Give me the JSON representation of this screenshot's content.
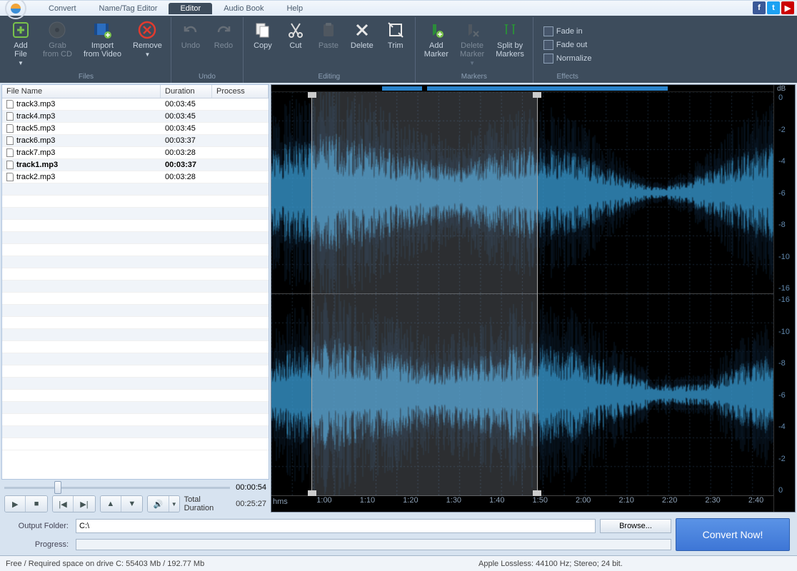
{
  "menu": {
    "tabs": [
      "Convert",
      "Name/Tag Editor",
      "Editor",
      "Audio Book",
      "Help"
    ],
    "active": 2
  },
  "ribbon": {
    "files": {
      "label": "Files",
      "add": "Add\nFile",
      "grab": "Grab\nfrom CD",
      "import": "Import\nfrom Video",
      "remove": "Remove"
    },
    "undo": {
      "label": "Undo",
      "undo": "Undo",
      "redo": "Redo"
    },
    "editing": {
      "label": "Editing",
      "copy": "Copy",
      "cut": "Cut",
      "paste": "Paste",
      "delete": "Delete",
      "trim": "Trim"
    },
    "markers": {
      "label": "Markers",
      "add": "Add\nMarker",
      "del": "Delete\nMarker",
      "split": "Split by\nMarkers"
    },
    "effects": {
      "label": "Effects",
      "fadein": "Fade in",
      "fadeout": "Fade out",
      "normalize": "Normalize"
    }
  },
  "filelist": {
    "headers": {
      "name": "File Name",
      "duration": "Duration",
      "process": "Process"
    },
    "rows": [
      {
        "name": "track3.mp3",
        "dur": "00:03:45"
      },
      {
        "name": "track4.mp3",
        "dur": "00:03:45"
      },
      {
        "name": "track5.mp3",
        "dur": "00:03:45"
      },
      {
        "name": "track6.mp3",
        "dur": "00:03:37"
      },
      {
        "name": "track7.mp3",
        "dur": "00:03:28"
      },
      {
        "name": "track1.mp3",
        "dur": "00:03:37",
        "selected": true
      },
      {
        "name": "track2.mp3",
        "dur": "00:03:28"
      }
    ],
    "seek_time": "00:00:54",
    "total_label": "Total Duration",
    "total_value": "00:25:27"
  },
  "waveform": {
    "timeline_unit": "hms",
    "ticks": [
      "1:00",
      "1:10",
      "1:20",
      "1:30",
      "1:40",
      "1:50",
      "2:00",
      "2:10",
      "2:20",
      "2:30",
      "2:40"
    ],
    "db_unit": "dB",
    "db_values": [
      "0",
      "-2",
      "-4",
      "-6",
      "-8",
      "-10",
      "-16",
      "-16",
      "-10",
      "-8",
      "-6",
      "-4",
      "-2",
      "0"
    ],
    "selection": {
      "start_pct": 8,
      "end_pct": 53
    },
    "marker_segments": [
      {
        "l": 22,
        "w": 8
      },
      {
        "l": 31,
        "w": 48
      }
    ]
  },
  "output": {
    "folder_label": "Output Folder:",
    "folder_value": "C:\\",
    "browse": "Browse...",
    "progress_label": "Progress:",
    "convert": "Convert Now!"
  },
  "status": {
    "left": "Free / Required space on drive  C: 55403 Mb / 192.77 Mb",
    "right": "Apple Lossless: 44100  Hz; Stereo; 24 bit."
  }
}
